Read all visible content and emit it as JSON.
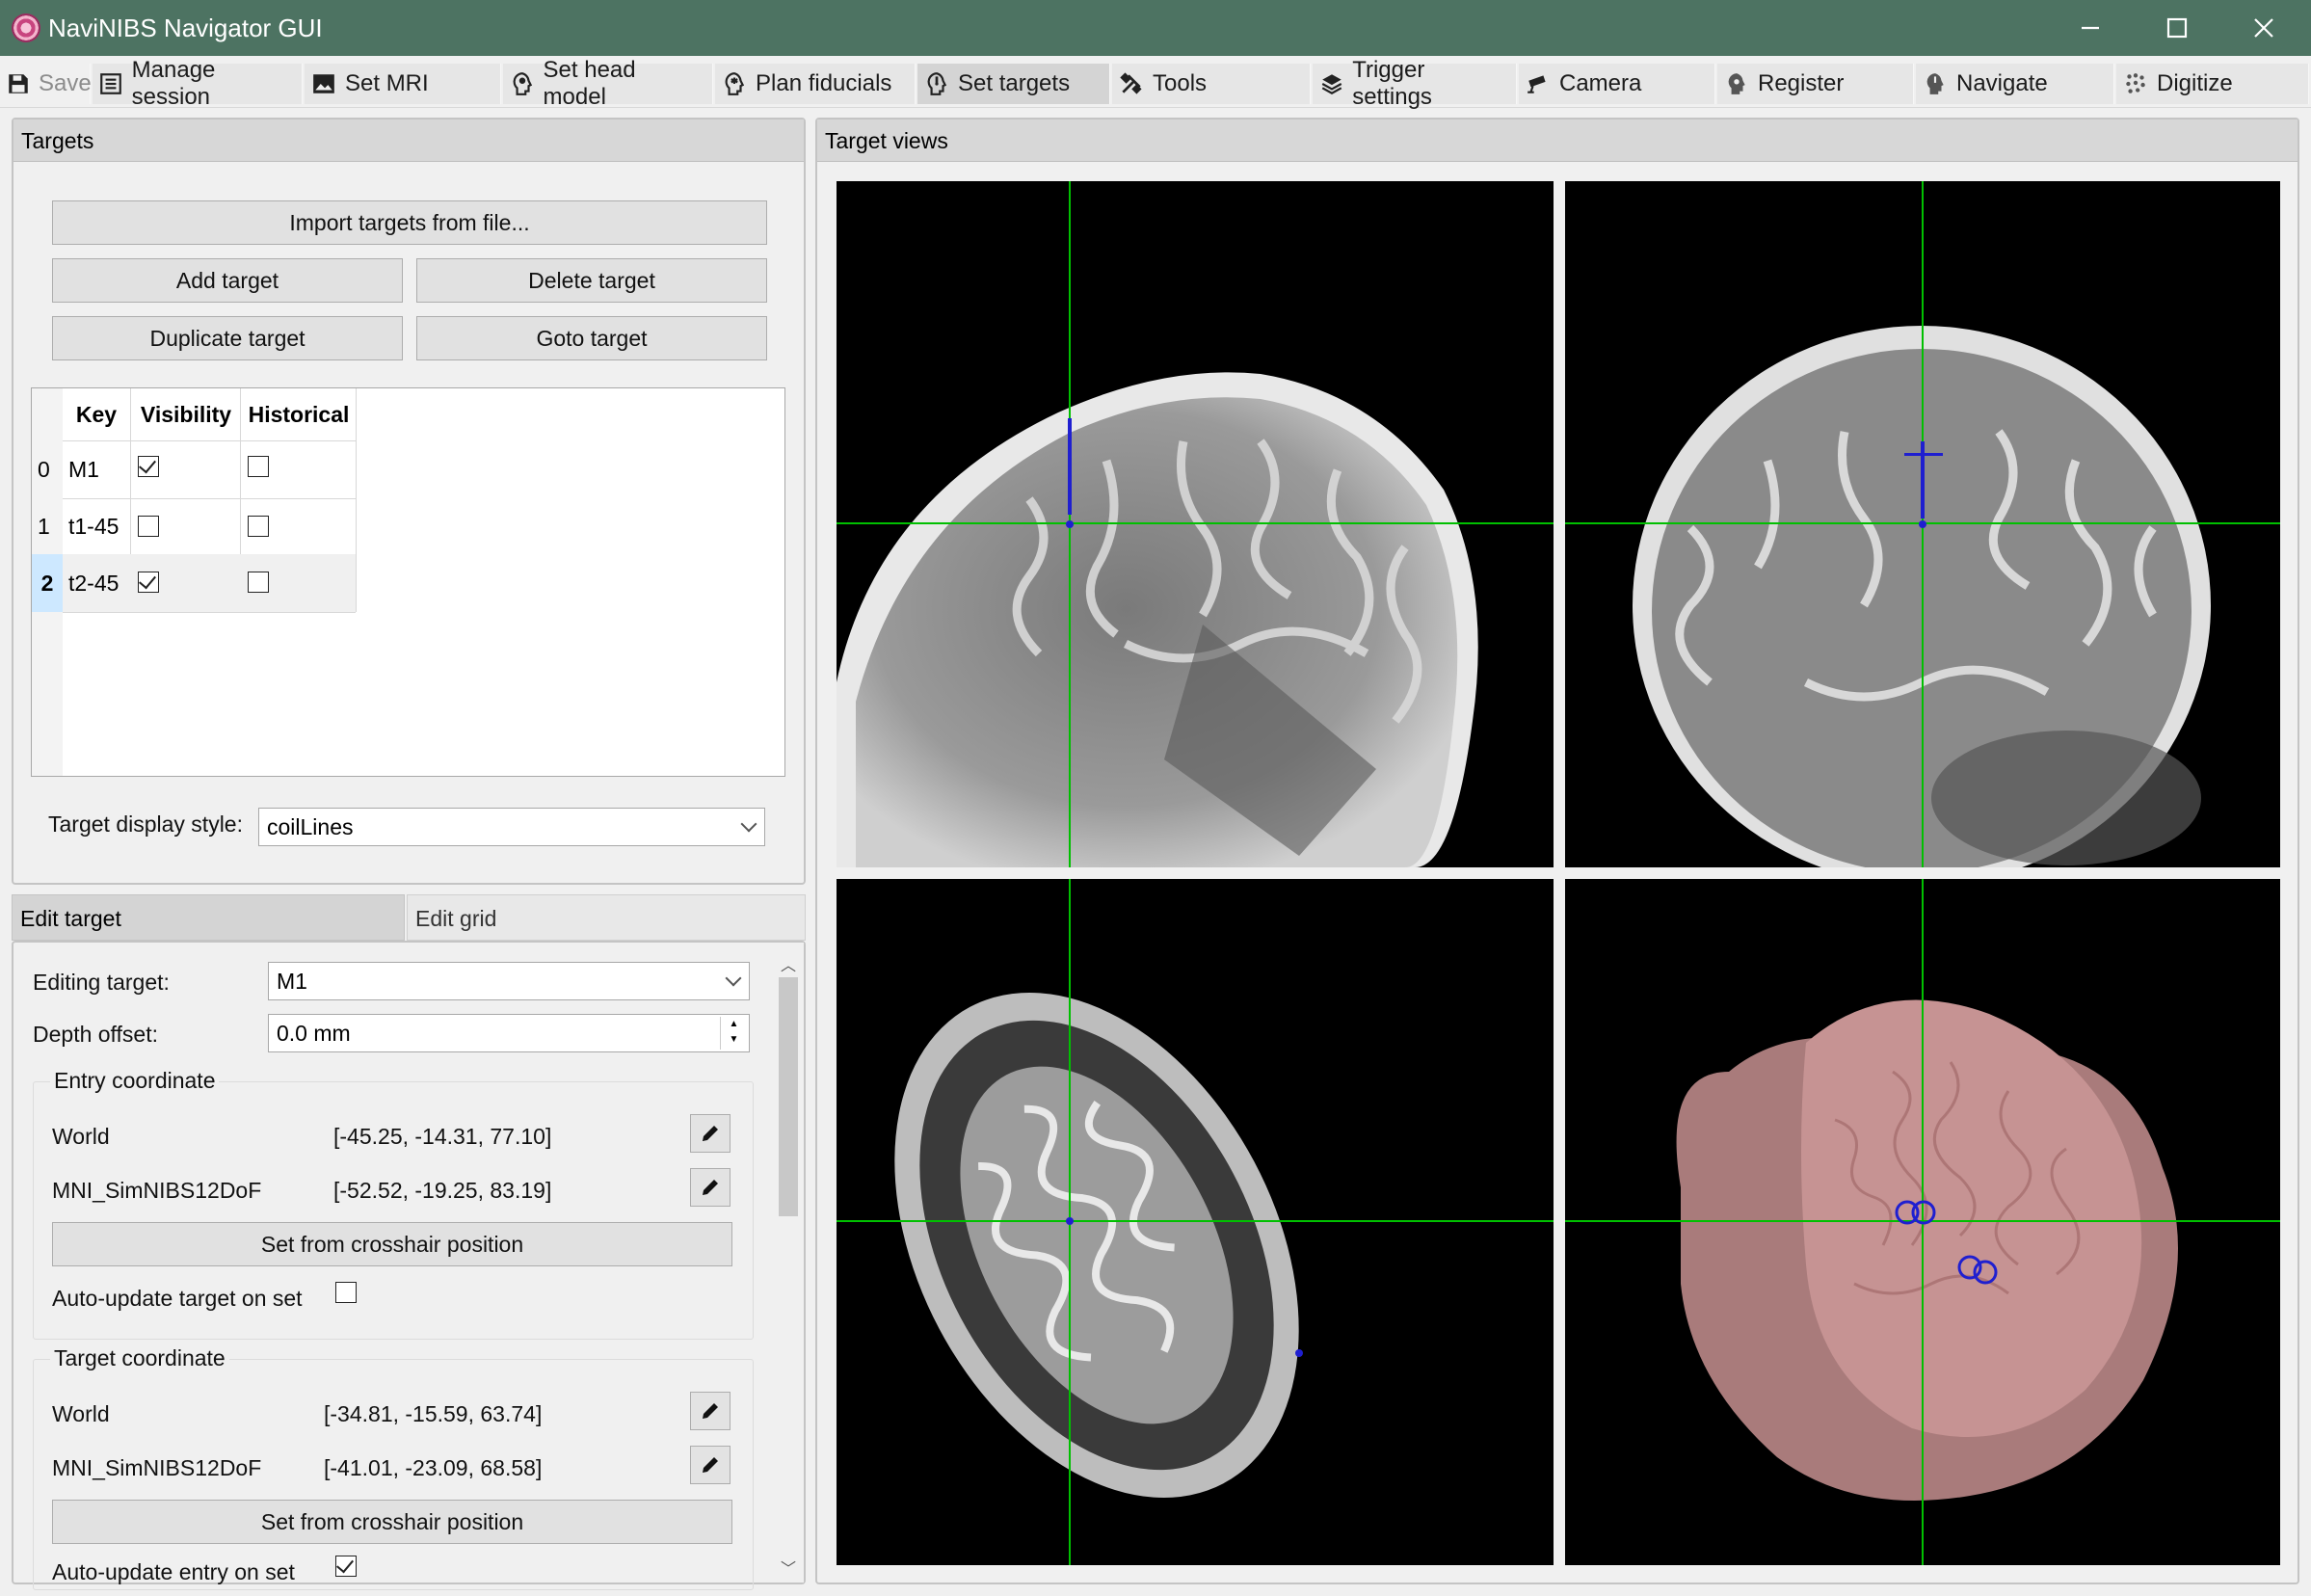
{
  "window": {
    "title": "NaviNIBS Navigator GUI"
  },
  "toolbar": {
    "save": "Save",
    "tabs": [
      "Manage session",
      "Set MRI",
      "Set head model",
      "Plan fiducials",
      "Set targets",
      "Tools",
      "Trigger settings",
      "Camera",
      "Register",
      "Navigate",
      "Digitize"
    ],
    "active_tab": "Set targets"
  },
  "targets_panel": {
    "title": "Targets",
    "import_button": "Import targets from file...",
    "add_button": "Add target",
    "delete_button": "Delete target",
    "duplicate_button": "Duplicate target",
    "goto_button": "Goto target",
    "table": {
      "headers": [
        "Key",
        "Visibility",
        "Historical"
      ],
      "rows": [
        {
          "index": "0",
          "key": "M1",
          "visible": true,
          "historical": false
        },
        {
          "index": "1",
          "key": "t1-45",
          "visible": false,
          "historical": false
        },
        {
          "index": "2",
          "key": "t2-45",
          "visible": true,
          "historical": false
        }
      ],
      "selected_row": 2
    },
    "display_style_label": "Target display style:",
    "display_style_value": "coilLines"
  },
  "edit_panel": {
    "tabs": [
      "Edit target",
      "Edit grid"
    ],
    "active_tab": "Edit target",
    "editing_target_label": "Editing target:",
    "editing_target_value": "M1",
    "depth_offset_label": "Depth offset:",
    "depth_offset_value": "0.0 mm",
    "entry": {
      "title": "Entry coordinate",
      "world_label": "World",
      "world_value": "[-45.25, -14.31, 77.10]",
      "mni_label": "MNI_SimNIBS12DoF",
      "mni_value": "[-52.52, -19.25, 83.19]",
      "set_button": "Set from crosshair position",
      "auto_update_label": "Auto-update target on set",
      "auto_update_checked": false
    },
    "target": {
      "title": "Target coordinate",
      "world_label": "World",
      "world_value": "[-34.81, -15.59, 63.74]",
      "mni_label": "MNI_SimNIBS12DoF",
      "mni_value": "[-41.01, -23.09, 68.58]",
      "set_button": "Set from crosshair position",
      "auto_update_label": "Auto-update entry on set",
      "auto_update_checked": true
    }
  },
  "views_panel": {
    "title": "Target views"
  },
  "colors": {
    "title_bar": "#4d7362",
    "crosshair": "#00c000",
    "target_marker": "#1f1fd0",
    "head_surface": "#c69393",
    "selected_row_header": "#cde8ff"
  }
}
